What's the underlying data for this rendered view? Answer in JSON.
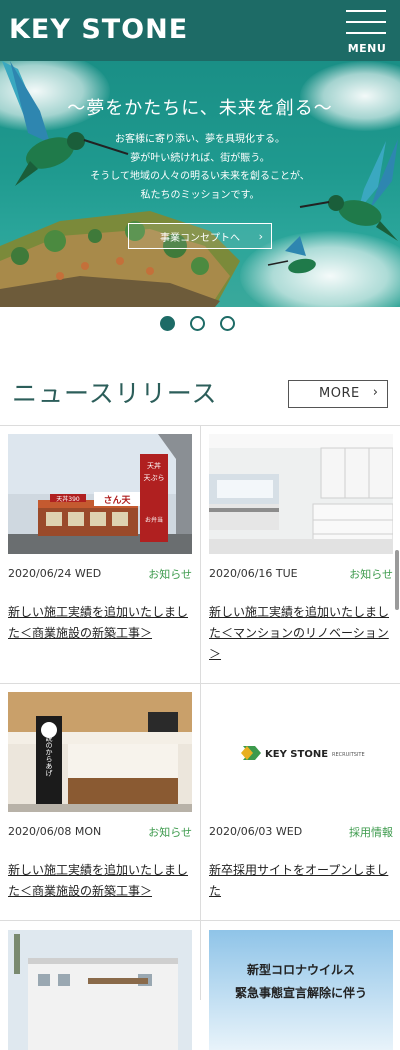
{
  "header": {
    "logo": "KEY STONE",
    "menu_label": "MENU"
  },
  "hero": {
    "title": "〜夢をかたちに、未来を創る〜",
    "lines": [
      "お客様に寄り添い、夢を具現化する。",
      "夢が叶い続ければ、街が賑う。",
      "そうして地域の人々の明るい未来を創ることが、",
      "私たちのミッションです。"
    ],
    "button_label": "事業コンセプトへ",
    "button_chevron": "›"
  },
  "carousel": {
    "slides": 3,
    "active": 0
  },
  "news": {
    "title": "ニュースリリース",
    "more_label": "MORE",
    "more_chevron": "›",
    "items": [
      {
        "date": "2020/06/24 WED",
        "category": "お知らせ",
        "title": "新しい施工実績を追加いたしました＜商業施設の新築工事＞",
        "image": "storefront-photo",
        "sign_text_1": "天丼",
        "sign_text_2": "天ぷら",
        "sign_text_3": "さん天",
        "sign_text_4": "天丼390",
        "sign_text_5": "お弁当"
      },
      {
        "date": "2020/06/16 TUE",
        "category": "お知らせ",
        "title": "新しい施工実績を追加いたしました＜マンションのリノベーション＞",
        "image": "kitchen-photo"
      },
      {
        "date": "2020/06/08 MON",
        "category": "お知らせ",
        "title": "新しい施工実績を追加いたしました＜商業施設の新築工事＞",
        "image": "restaurant-counter-photo",
        "sign_text_1": "伝説のからあげ"
      },
      {
        "date": "2020/06/03 WED",
        "category": "採用情報",
        "title": "新卒採用サイトをオープンしました",
        "image": "recruit-logo",
        "logo_main": "KEY STONE",
        "logo_sub": "RECRUITSITE"
      },
      {
        "date": "",
        "category": "",
        "title": "",
        "image": "building-photo"
      },
      {
        "date": "",
        "category": "",
        "title": "",
        "image": "covid-notice",
        "notice_line_1": "新型コロナウイルス",
        "notice_line_2": "緊急事態宣言解除に伴う"
      }
    ]
  },
  "colors": {
    "brand": "#1d6b66",
    "category_green": "#3c9a4c",
    "hero_teal": "#1f9a8f"
  }
}
